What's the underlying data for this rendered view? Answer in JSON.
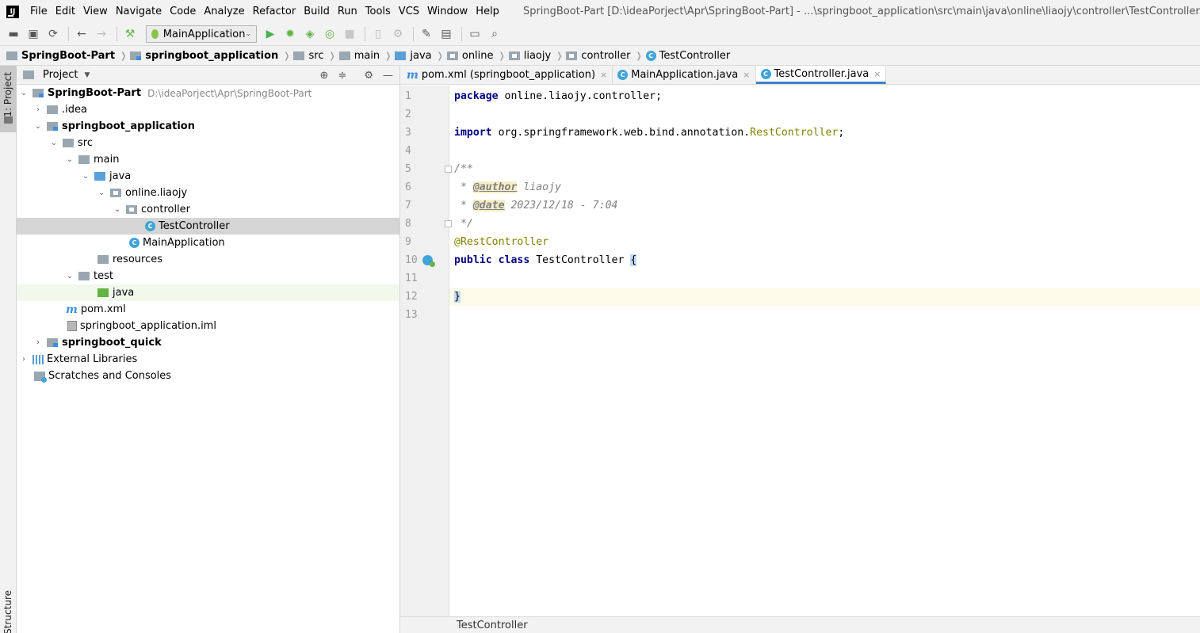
{
  "menubar": {
    "items": [
      "File",
      "Edit",
      "View",
      "Navigate",
      "Code",
      "Analyze",
      "Refactor",
      "Build",
      "Run",
      "Tools",
      "VCS",
      "Window",
      "Help"
    ],
    "window_title": "SpringBoot-Part [D:\\ideaPorject\\Apr\\SpringBoot-Part] - ...\\springboot_application\\src\\main\\java\\online\\liaojy\\controller\\TestController.java [springboot_application]"
  },
  "toolbar": {
    "run_config": "MainApplication"
  },
  "breadcrumb": [
    "SpringBoot-Part",
    "springboot_application",
    "src",
    "main",
    "java",
    "online",
    "liaojy",
    "controller",
    "TestController"
  ],
  "sidebar": {
    "project_tab": "1: Project",
    "structure_tab": "Structure"
  },
  "project_panel": {
    "title": "Project",
    "root_path": "D:\\ideaPorject\\Apr\\SpringBoot-Part",
    "nodes": [
      "SpringBoot-Part",
      ".idea",
      "springboot_application",
      "src",
      "main",
      "java",
      "online.liaojy",
      "controller",
      "TestController",
      "MainApplication",
      "resources",
      "test",
      "java",
      "pom.xml",
      "springboot_application.iml",
      "springboot_quick",
      "External Libraries",
      "Scratches and Consoles"
    ]
  },
  "editor": {
    "tabs": [
      "pom.xml (springboot_application)",
      "MainApplication.java",
      "TestController.java"
    ],
    "line_numbers": [
      "1",
      "2",
      "3",
      "4",
      "5",
      "6",
      "7",
      "8",
      "9",
      "10",
      "11",
      "12",
      "13"
    ],
    "code": {
      "l1_kw": "package",
      "l1_rest": " online.liaojy.controller;",
      "l3_kw": "import",
      "l3_pkg": " org.springframework.web.bind.annotation.",
      "l3_cls": "RestController",
      "l3_end": ";",
      "l5": "/**",
      "l6_star": " * ",
      "l6_tag": "@author",
      "l6_val": " liaojy",
      "l7_star": " * ",
      "l7_tag": "@date",
      "l7_val": " 2023/12/18 - 7:04",
      "l8": " */",
      "l9": "@RestController",
      "l10_kw1": "public",
      "l10_kw2": "class",
      "l10_name": " TestController ",
      "l10_brace": "{",
      "l12_brace": "}"
    },
    "status": "TestController"
  }
}
